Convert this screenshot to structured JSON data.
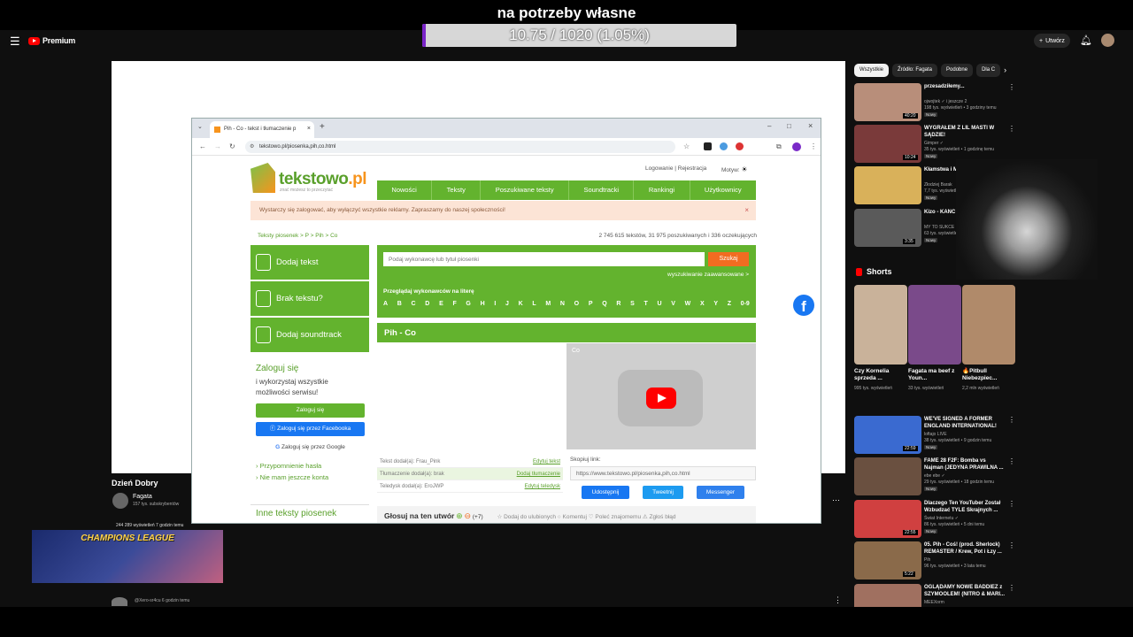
{
  "overlay": {
    "title": "na potrzeby własne",
    "progress_text": "10.75 / 1020 (1.05%)",
    "progress_fraction": 0.0105,
    "progress_color": "#7a24c8"
  },
  "youtube": {
    "logo_text": "Premium",
    "create_label": "Utwórz",
    "channel_title": "Dzień Dobry",
    "channel_name": "Fagata",
    "subscribers": "157 tys. subskrybentów",
    "thumb_text": "CHAMPIONS LEAGUE",
    "thumb_caption": "244 289 wyświetleń  7 godzin temu",
    "comment": "@Xero-sr4cu 6 godzin temu",
    "chips": [
      "Wszystkie",
      "Źródło: Fagata",
      "Podobne",
      "Dla C"
    ],
    "shorts_label": "Shorts",
    "recs": [
      {
        "title": "przesadziłemy...",
        "channel": "ojwojtek ✓ i jeszcze 2",
        "views": "198 tys. wyświetleń • 3 godziny temu",
        "badge": "Nowy",
        "duration": "40:20",
        "color": "#b88e7a"
      },
      {
        "title": "WYGRAŁEM Z LIL MASTI W SĄDZIE!",
        "channel": "Gimper ✓",
        "views": "35 tys. wyświetleń • 1 godzinę temu",
        "badge": "Nowy",
        "duration": "10:24",
        "color": "#7a3a3a"
      },
      {
        "title": "Kłamstwa i M Dziennikarzy",
        "channel": "Złodziej Barak",
        "views": "7,7 tys. wyświetleń",
        "badge": "Nowy",
        "duration": "",
        "color": "#d9b15a"
      },
      {
        "title": "Kizo - KANC",
        "channel": "MY TO SUKCE",
        "views": "63 tys. wyświetleń",
        "badge": "Nowy",
        "duration": "3:35",
        "color": "#5a5a5a"
      },
      {
        "title": "WE'VE SIGNED A FORMER ENGLAND INTERNATIONAL!",
        "channel": "loftajo LIVE",
        "views": "38 tys. wyświetleń • 9 godzin temu",
        "badge": "Nowy",
        "duration": "22:59",
        "color": "#3a6ad0"
      },
      {
        "title": "FAME 28 F2F: Bomba vs Najman (JEDYNA PRAWILNA ...",
        "channel": "ebe ebe ✓",
        "views": "29 tys. wyświetleń • 18 godzin temu",
        "badge": "Nowy",
        "duration": "",
        "color": "#6a5040"
      },
      {
        "title": "Dlaczego Ten YouTuber Został Wzbudzać TYLE Skrajnych ...",
        "channel": "Świat Internetu ✓",
        "views": "86 tys. wyświetleń • 5 dni temu",
        "badge": "Nowy",
        "duration": "22:55",
        "color": "#d04040"
      },
      {
        "title": "05. Pih - Coś! (prod. Sherlock) REMASTER / Krew, Pot i Łzy ...",
        "channel": "Pih",
        "views": "96 tys. wyświetleń • 3 lata temu",
        "badge": "",
        "duration": "5:22",
        "color": "#8a6a4a"
      },
      {
        "title": "OGLĄDAMY NOWE BADDIEZ z SZYMOOLEM! (NITRO & MARI...",
        "channel": "MEEXorm",
        "views": "",
        "badge": "",
        "duration": "",
        "color": "#a07060"
      }
    ],
    "shorts": [
      {
        "title": "Czy Kornelia sprzeda ...",
        "views": "995 tys. wyświetleń",
        "color": "#c9b29a"
      },
      {
        "title": "Fagata ma beef z Youn...",
        "views": "33 tys. wyświetleń",
        "color": "#7a4a8a"
      },
      {
        "title": "🔥Pitbull Niebezpiec...",
        "views": "2,2 mln wyświetleń",
        "color": "#b08a6a"
      }
    ]
  },
  "browser": {
    "tab_title": "Pih - Co - tekst i tłumaczenie p",
    "url": "tekstowo.pl/piosenka,pih,co.html"
  },
  "site": {
    "logo_main": "tekstowo",
    "logo_tld": ".pl",
    "logo_sub": "znać możesz to przeczytać",
    "login_links": "Logowanie | Rejestracja",
    "theme_label": "Motyw:",
    "nav": [
      "Nowości",
      "Teksty",
      "Poszukiwane teksty",
      "Soundtracki",
      "Rankingi",
      "Użytkownicy"
    ],
    "notice": "Wystarczy się zalogować, aby wyłączyć wszystkie reklamy. Zapraszamy do naszej społeczności!",
    "breadcrumb": "Teksty piosenek > P > Pih > Co",
    "stats": "2 745 615 tekstów, 31 975 poszukiwanych i 336 oczekujących",
    "side_buttons": [
      "Dodaj tekst",
      "Brak tekstu?",
      "Dodaj soundtrack"
    ],
    "search_placeholder": "Podaj wykonawcę lub tytuł piosenki",
    "search_button": "Szukaj",
    "advanced_search": "wyszukiwanie zaawansowane >",
    "browse_label": "Przeglądaj wykonawców na literę",
    "letters": [
      "A",
      "B",
      "C",
      "D",
      "E",
      "F",
      "G",
      "H",
      "I",
      "J",
      "K",
      "L",
      "M",
      "N",
      "O",
      "P",
      "Q",
      "R",
      "S",
      "T",
      "U",
      "V",
      "W",
      "X",
      "Y",
      "Z",
      "0-9"
    ],
    "song_title": "Pih - Co",
    "video_title": "Co",
    "login_head": "Zaloguj się",
    "login_desc": "i wykorzystaj wszystkie możliwości serwisu!",
    "login_btn": "Zaloguj się",
    "login_fb": "Zaloguj się przez Facebooka",
    "login_google": "Zaloguj się przez Google",
    "forgot_password": "Przypomnienie hasła",
    "no_account": "Nie mam jeszcze konta",
    "meta": [
      {
        "left": "Tekst dodał(a): Frau_Pink",
        "right": "Edytuj tekst"
      },
      {
        "left": "Tłumaczenie dodał(a): brak",
        "right": "Dodaj tłumaczenie"
      },
      {
        "left": "Teledysk dodał(a): EroJWP",
        "right": "Edytuj teledysk"
      }
    ],
    "copy_label": "Skopiuj link:",
    "copy_value": "https://www.tekstowo.pl/piosenka,pih,co.html",
    "share": [
      "Udostępnij",
      "Tweetnij",
      "Messenger"
    ],
    "other_songs": "Inne teksty piosenek",
    "vote_label": "Głosuj na ten utwór",
    "vote_count": "(+7)",
    "actions": "☆ Dodaj do ulubionych   ○ Komentuj   ♡ Poleć znajomemu   ⚠ Zgłoś błąd",
    "accent": "#63b32e"
  }
}
